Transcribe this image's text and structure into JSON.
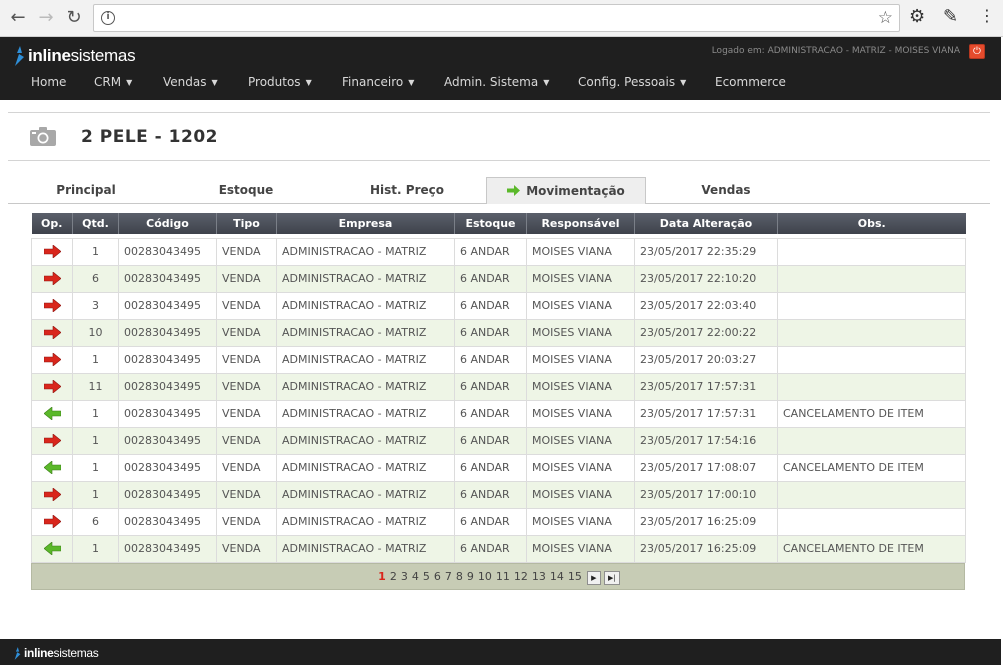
{
  "browser": {
    "back_icon": "arrow-left-icon",
    "forward_icon": "arrow-right-icon",
    "reload_icon": "reload-icon",
    "address_value": ""
  },
  "header": {
    "logo_bold": "inline",
    "logo_light": "sistemas",
    "login_info": "Logado em: ADMINISTRACAO - MATRIZ - MOISES VIANA",
    "menu": [
      {
        "label": "Home",
        "has_dropdown": false
      },
      {
        "label": "CRM",
        "has_dropdown": true
      },
      {
        "label": "Vendas",
        "has_dropdown": true
      },
      {
        "label": "Produtos",
        "has_dropdown": true
      },
      {
        "label": "Financeiro",
        "has_dropdown": true
      },
      {
        "label": "Admin. Sistema",
        "has_dropdown": true
      },
      {
        "label": "Config. Pessoais",
        "has_dropdown": true
      },
      {
        "label": "Ecommerce",
        "has_dropdown": false
      }
    ]
  },
  "product": {
    "title": "2 PELE - 1202"
  },
  "tabs": [
    {
      "label": "Principal",
      "active": false
    },
    {
      "label": "Estoque",
      "active": false
    },
    {
      "label": "Hist. Preço",
      "active": false
    },
    {
      "label": "Movimentação",
      "active": true
    },
    {
      "label": "Vendas",
      "active": false
    }
  ],
  "table": {
    "columns": [
      "Op.",
      "Qtd.",
      "Código",
      "Tipo",
      "Empresa",
      "Estoque",
      "Responsável",
      "Data Alteração",
      "Obs."
    ],
    "rows": [
      {
        "op": "out",
        "qtd": "1",
        "codigo": "00283043495",
        "tipo": "VENDA",
        "empresa": "ADMINISTRACAO - MATRIZ",
        "estoque": "6 ANDAR",
        "responsavel": "MOISES VIANA",
        "data": "23/05/2017 22:35:29",
        "obs": ""
      },
      {
        "op": "out",
        "qtd": "6",
        "codigo": "00283043495",
        "tipo": "VENDA",
        "empresa": "ADMINISTRACAO - MATRIZ",
        "estoque": "6 ANDAR",
        "responsavel": "MOISES VIANA",
        "data": "23/05/2017 22:10:20",
        "obs": ""
      },
      {
        "op": "out",
        "qtd": "3",
        "codigo": "00283043495",
        "tipo": "VENDA",
        "empresa": "ADMINISTRACAO - MATRIZ",
        "estoque": "6 ANDAR",
        "responsavel": "MOISES VIANA",
        "data": "23/05/2017 22:03:40",
        "obs": ""
      },
      {
        "op": "out",
        "qtd": "10",
        "codigo": "00283043495",
        "tipo": "VENDA",
        "empresa": "ADMINISTRACAO - MATRIZ",
        "estoque": "6 ANDAR",
        "responsavel": "MOISES VIANA",
        "data": "23/05/2017 22:00:22",
        "obs": ""
      },
      {
        "op": "out",
        "qtd": "1",
        "codigo": "00283043495",
        "tipo": "VENDA",
        "empresa": "ADMINISTRACAO - MATRIZ",
        "estoque": "6 ANDAR",
        "responsavel": "MOISES VIANA",
        "data": "23/05/2017 20:03:27",
        "obs": ""
      },
      {
        "op": "out",
        "qtd": "11",
        "codigo": "00283043495",
        "tipo": "VENDA",
        "empresa": "ADMINISTRACAO - MATRIZ",
        "estoque": "6 ANDAR",
        "responsavel": "MOISES VIANA",
        "data": "23/05/2017 17:57:31",
        "obs": ""
      },
      {
        "op": "in",
        "qtd": "1",
        "codigo": "00283043495",
        "tipo": "VENDA",
        "empresa": "ADMINISTRACAO - MATRIZ",
        "estoque": "6 ANDAR",
        "responsavel": "MOISES VIANA",
        "data": "23/05/2017 17:57:31",
        "obs": "CANCELAMENTO DE ITEM"
      },
      {
        "op": "out",
        "qtd": "1",
        "codigo": "00283043495",
        "tipo": "VENDA",
        "empresa": "ADMINISTRACAO - MATRIZ",
        "estoque": "6 ANDAR",
        "responsavel": "MOISES VIANA",
        "data": "23/05/2017 17:54:16",
        "obs": ""
      },
      {
        "op": "in",
        "qtd": "1",
        "codigo": "00283043495",
        "tipo": "VENDA",
        "empresa": "ADMINISTRACAO - MATRIZ",
        "estoque": "6 ANDAR",
        "responsavel": "MOISES VIANA",
        "data": "23/05/2017 17:08:07",
        "obs": "CANCELAMENTO DE ITEM"
      },
      {
        "op": "out",
        "qtd": "1",
        "codigo": "00283043495",
        "tipo": "VENDA",
        "empresa": "ADMINISTRACAO - MATRIZ",
        "estoque": "6 ANDAR",
        "responsavel": "MOISES VIANA",
        "data": "23/05/2017 17:00:10",
        "obs": ""
      },
      {
        "op": "out",
        "qtd": "6",
        "codigo": "00283043495",
        "tipo": "VENDA",
        "empresa": "ADMINISTRACAO - MATRIZ",
        "estoque": "6 ANDAR",
        "responsavel": "MOISES VIANA",
        "data": "23/05/2017 16:25:09",
        "obs": ""
      },
      {
        "op": "in",
        "qtd": "1",
        "codigo": "00283043495",
        "tipo": "VENDA",
        "empresa": "ADMINISTRACAO - MATRIZ",
        "estoque": "6 ANDAR",
        "responsavel": "MOISES VIANA",
        "data": "23/05/2017 16:25:09",
        "obs": "CANCELAMENTO DE ITEM"
      }
    ]
  },
  "pager": {
    "pages": [
      "1",
      "2",
      "3",
      "4",
      "5",
      "6",
      "7",
      "8",
      "9",
      "10",
      "11",
      "12",
      "13",
      "14",
      "15"
    ],
    "current": "1",
    "next_icon": "next-page-icon",
    "last_icon": "last-page-icon"
  },
  "footer": {
    "logo_bold": "inline",
    "logo_light": "sistemas"
  },
  "colors": {
    "header_bg": "#1f1f1f",
    "row_alt": "#eef5e6",
    "pager_bg": "#c7ccb5",
    "arrow_out": "#d9261c",
    "arrow_in": "#5bb82a",
    "current_page": "#d9261c"
  }
}
